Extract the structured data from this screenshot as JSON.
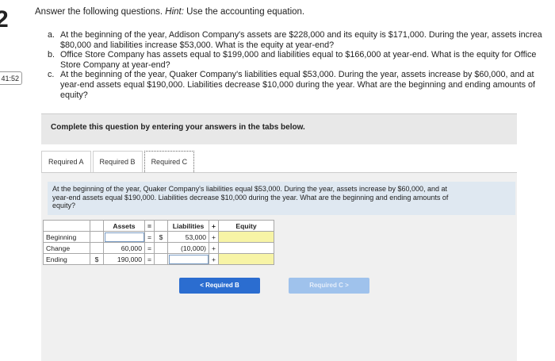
{
  "question_number": "2",
  "timer": "41:52",
  "intro": {
    "lead": "Answer the following questions. ",
    "hint_label": "Hint:",
    "hint_text": " Use the accounting equation."
  },
  "questions": [
    {
      "label": "a.",
      "line1": "At the beginning of the year, Addison Company's assets are $228,000 and its equity is $171,000. During the year, assets increa",
      "line2": "$80,000 and liabilities increase $53,000. What is the equity at year-end?"
    },
    {
      "label": "b.",
      "line1": "Office Store Company has assets equal to $199,000 and liabilities equal to $166,000 at year-end. What is the equity for Office",
      "line2": "Store Company at year-end?"
    },
    {
      "label": "c.",
      "line1": "At the beginning of the year, Quaker Company's liabilities equal $53,000. During the year, assets increase by $60,000, and at",
      "line2": "year-end assets equal $190,000. Liabilities decrease $10,000 during the year. What are the beginning and ending amounts of",
      "line3": "equity?"
    }
  ],
  "panel_text": "Complete this question by entering your answers in the tabs below.",
  "tabs": [
    "Required A",
    "Required B",
    "Required C"
  ],
  "description": {
    "line1": "At the beginning of the year, Quaker Company's liabilities equal $53,000. During the year, assets increase by $60,000, and at",
    "line2": "year-end assets equal $190,000. Liabilities decrease $10,000 during the year. What are the beginning and ending amounts of",
    "line3": "equity?"
  },
  "table": {
    "headers": {
      "assets": "Assets",
      "eq": "=",
      "liabilities": "Liabilities",
      "plus": "+",
      "equity": "Equity"
    },
    "rows": [
      {
        "label": "Beginning",
        "asset_dollar": "",
        "asset_value": "",
        "op": "=",
        "liab_dollar": "$",
        "liab_value": "53,000",
        "plus": "+",
        "equity": ""
      },
      {
        "label": "Change",
        "asset_dollar": "",
        "asset_value": "60,000",
        "op": "=",
        "liab_dollar": "",
        "liab_value": "(10,000)",
        "plus": "+",
        "equity": ""
      },
      {
        "label": "Ending",
        "asset_dollar": "$",
        "asset_value": "190,000",
        "op": "=",
        "liab_dollar": "",
        "liab_value": "",
        "plus": "+",
        "equity": ""
      }
    ]
  },
  "buttons": {
    "prev": "< Required B",
    "next": "Required C >"
  },
  "colors": {
    "answer_highlight": "#f7f4a6",
    "primary_button": "#2b6dd0",
    "disabled_button": "#9fc2ec",
    "description_bg": "#dfe8f1"
  }
}
